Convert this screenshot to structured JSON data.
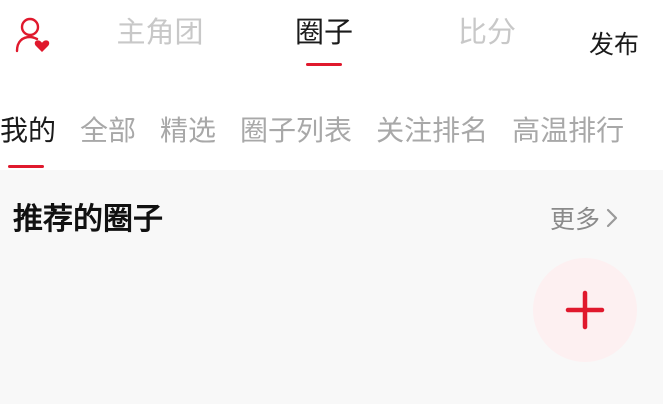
{
  "header": {
    "user_icon": "user-heart-icon",
    "tabs": [
      {
        "label": "主角团",
        "active": false
      },
      {
        "label": "圈子",
        "active": true
      },
      {
        "label": "比分",
        "active": false
      }
    ],
    "publish_label": "发布"
  },
  "sub_tabs": [
    {
      "label": "我的",
      "active": true
    },
    {
      "label": "全部",
      "active": false
    },
    {
      "label": "精选",
      "active": false
    },
    {
      "label": "圈子列表",
      "active": false
    },
    {
      "label": "关注排名",
      "active": false
    },
    {
      "label": "高温排行",
      "active": false
    }
  ],
  "section": {
    "title": "推荐的圈子",
    "more_label": "更多",
    "more_icon": "chevron-right-icon"
  },
  "fab": {
    "icon": "plus-icon"
  },
  "colors": {
    "accent": "#e0192d",
    "inactive_text": "#a8a8a8",
    "fab_background": "#fdf0f1"
  }
}
